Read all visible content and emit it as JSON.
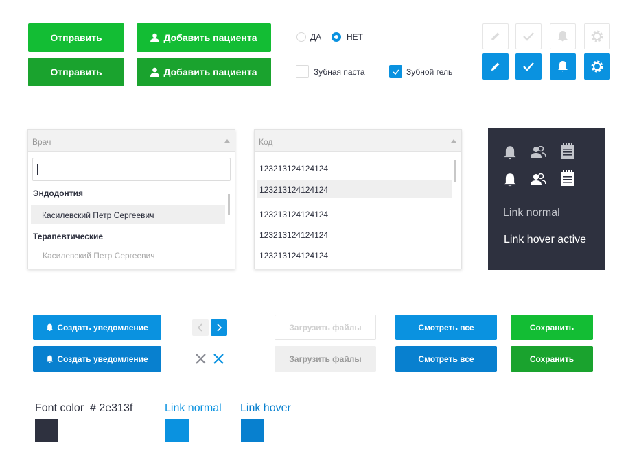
{
  "top_buttons": {
    "send_1": "Отправить",
    "send_2": "Отправить",
    "add_patient_1": "Добавить пациента",
    "add_patient_2": "Добавить пациента"
  },
  "radios": {
    "yes": "ДА",
    "no": "НЕТ",
    "selected": "НЕТ"
  },
  "checkboxes": {
    "toothpaste": "Зубная паста",
    "toothpaste_checked": false,
    "gel": "Зубной гель",
    "gel_checked": true
  },
  "icon_buttons": [
    "pencil-icon",
    "check-icon",
    "bell-icon",
    "gear-icon"
  ],
  "doctor_dropdown": {
    "placeholder": "Врач",
    "search_value": "",
    "groups": [
      {
        "title": "Эндодонтия",
        "items": [
          "Касилевский Петр Сергеевич"
        ]
      },
      {
        "title": "Терапевтические",
        "items": [
          "Касилевский Петр Сергеевич"
        ]
      }
    ]
  },
  "code_dropdown": {
    "placeholder": "Код",
    "items": [
      "123213124124124",
      "123213124124124",
      "123213124124124",
      "123213124124124",
      "123213124124124"
    ]
  },
  "dark_panel": {
    "icons": [
      "bell-icon",
      "users-icon",
      "notepad-icon"
    ],
    "link_normal": "Link normal",
    "link_hover": "Link hover active"
  },
  "bottom_buttons": {
    "create_notification_1": "Создать уведомление",
    "create_notification_2": "Создать уведомление",
    "upload_1": "Загрузить файлы",
    "upload_2": "Загрузить файлы",
    "view_all_1": "Смотреть все",
    "view_all_2": "Смотреть все",
    "save_1": "Сохранить",
    "save_2": "Сохранить"
  },
  "palette": {
    "font_color_label": "Font color  # 2e313f",
    "link_normal_label": "Link normal",
    "link_hover_label": "Link hover",
    "font_color": "#2e313f",
    "link_normal_color": "#0a92e0",
    "link_hover_color": "#0880cf"
  }
}
